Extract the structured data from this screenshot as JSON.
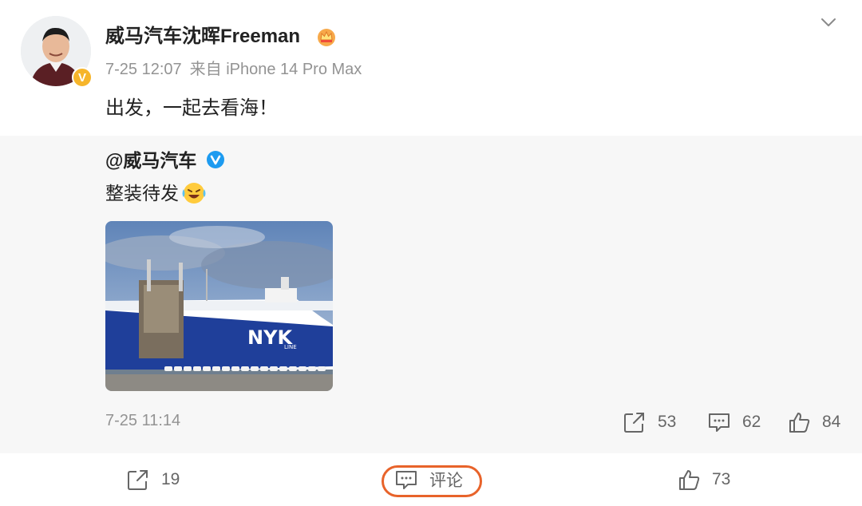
{
  "post": {
    "author": "威马汽车沈晖Freeman",
    "time": "7-25 12:07",
    "source": "来自 iPhone 14 Pro Max",
    "text": "出发，一起去看海！"
  },
  "repost": {
    "author": "@威马汽车",
    "text": "整装待发",
    "time": "7-25 11:14",
    "stats": {
      "shares": "53",
      "comments": "62",
      "likes": "84"
    },
    "photo_text": "NYK",
    "photo_subtext": "LINE"
  },
  "actions": {
    "share_count": "19",
    "comment_label": "评论",
    "like_count": "73"
  },
  "colors": {
    "accent_outline": "#e8632a",
    "verified_gold": "#f6b52b",
    "verified_blue": "#1d9bf0",
    "muted_text": "#939393"
  },
  "icons": [
    "chevron-down-icon",
    "crown-icon",
    "blue-v-icon",
    "laugh-cry-emoji-icon",
    "share-icon",
    "comment-icon",
    "like-icon"
  ]
}
